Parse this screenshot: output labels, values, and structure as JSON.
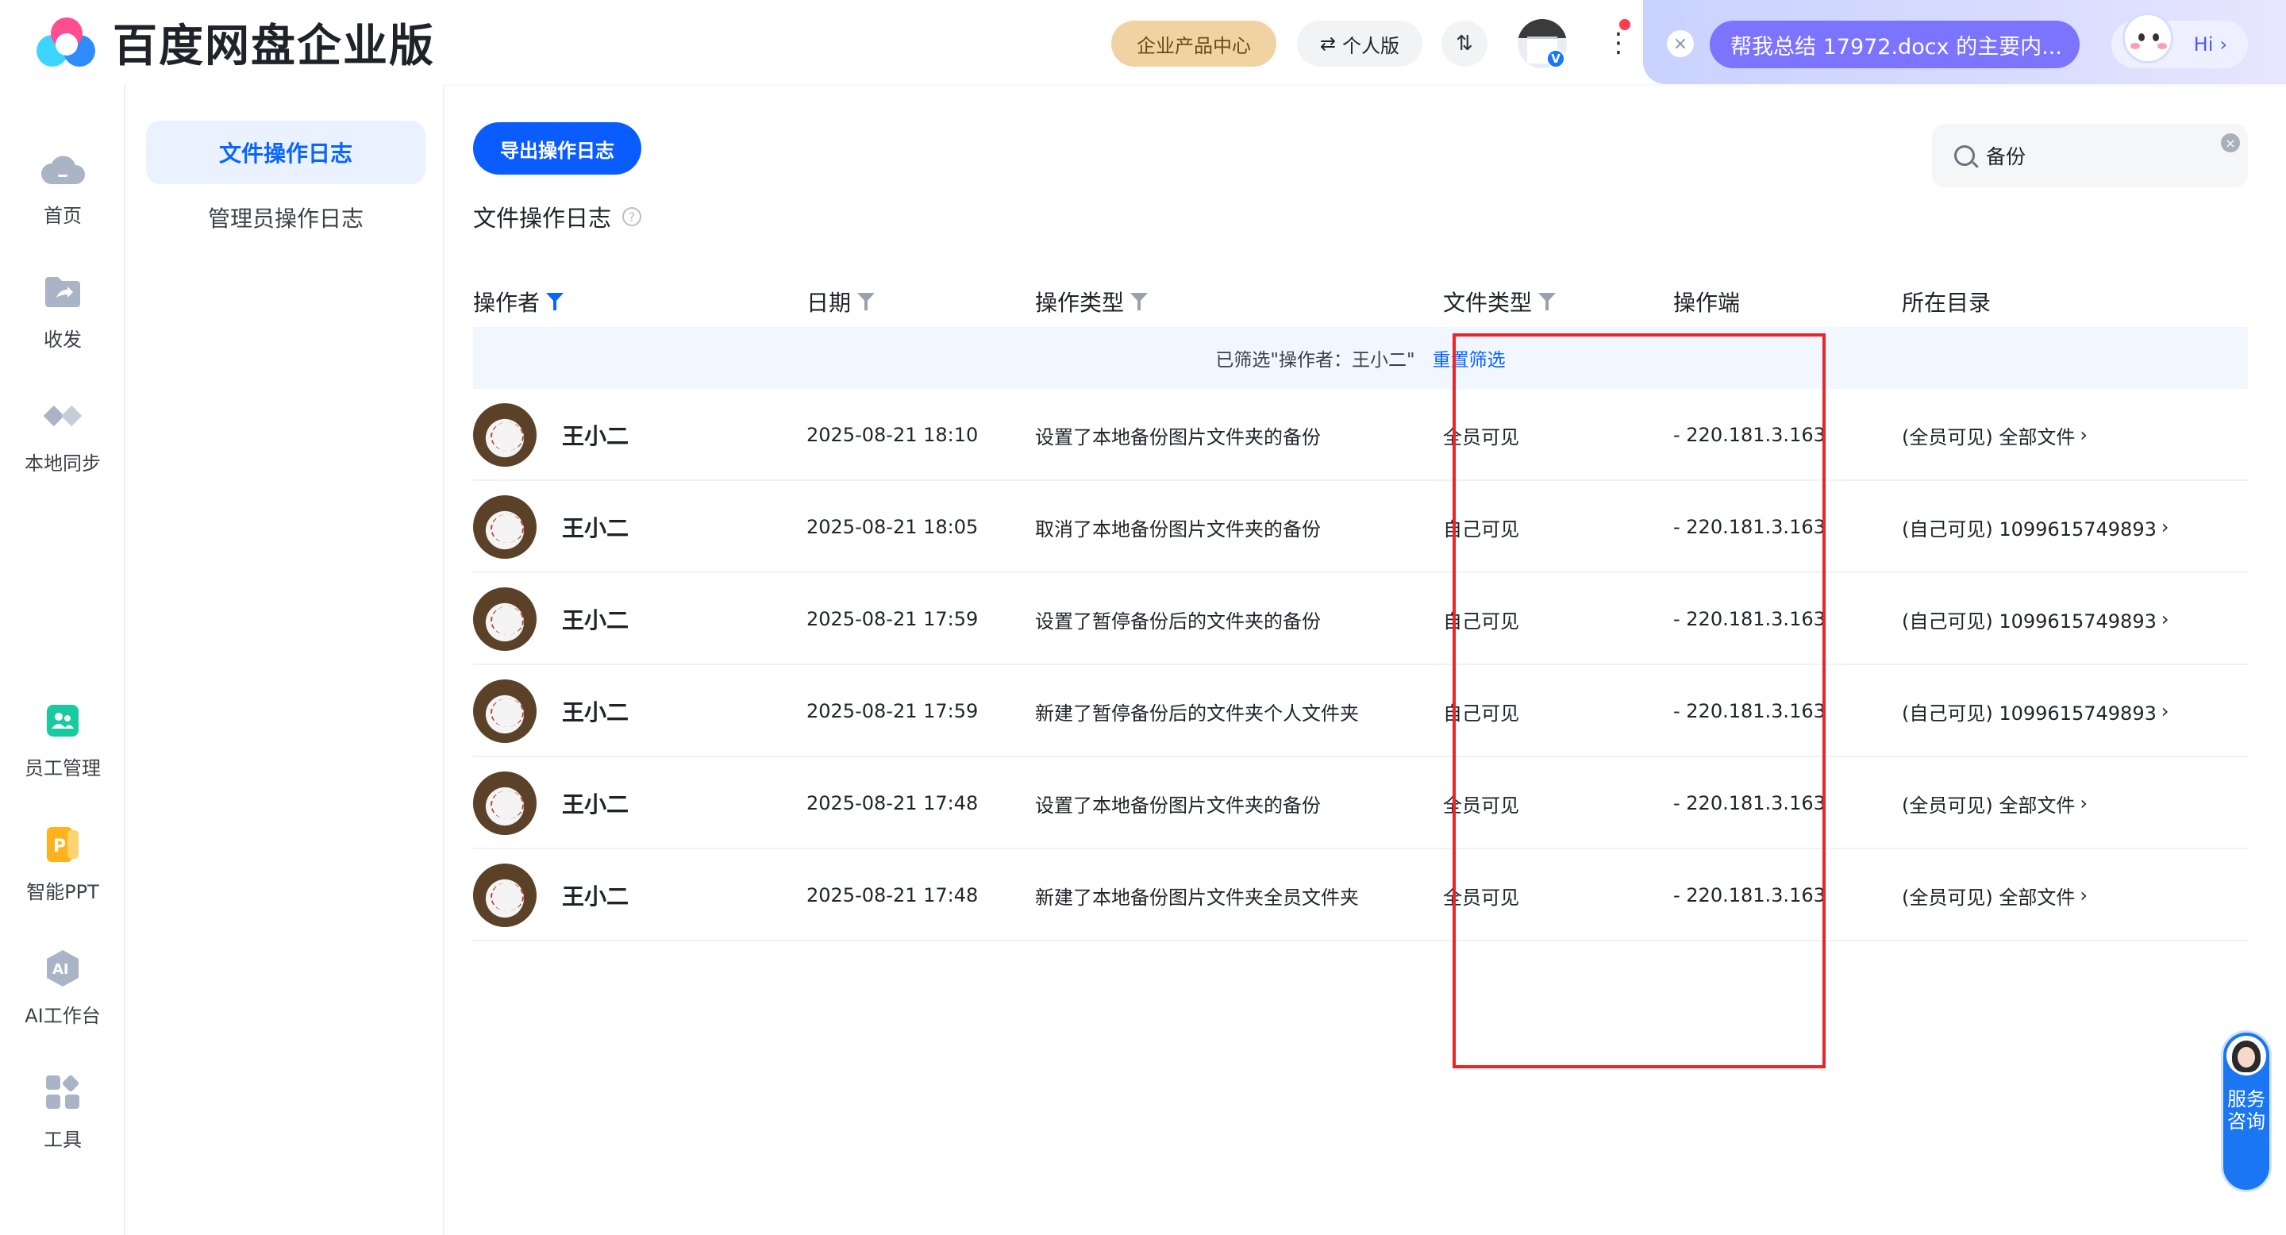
{
  "brand": {
    "name": "百度网盘企业版"
  },
  "header": {
    "enterprise_center": "企业产品中心",
    "personal_label": "个人版",
    "transfer_icon": "transfer-icon",
    "ai_prompt": "帮我总结 17972.docx 的主要内...",
    "ai_hi": "Hi",
    "badge": "V"
  },
  "rail": {
    "items": [
      {
        "label": "首页",
        "icon": "cloud-icon"
      },
      {
        "label": "收发",
        "icon": "folder-share-icon"
      },
      {
        "label": "本地同步",
        "icon": "sync-icon"
      },
      {
        "label": "员工管理",
        "icon": "staff-icon"
      },
      {
        "label": "智能PPT",
        "icon": "ppt-icon"
      },
      {
        "label": "AI工作台",
        "icon": "ai-workbench-icon"
      },
      {
        "label": "工具",
        "icon": "tools-icon"
      }
    ]
  },
  "subnav": {
    "items": [
      {
        "label": "文件操作日志",
        "active": true
      },
      {
        "label": "管理员操作日志",
        "active": false
      }
    ]
  },
  "main": {
    "export_button": "导出操作日志",
    "title": "文件操作日志",
    "help": "?",
    "search": {
      "value": "备份"
    }
  },
  "table": {
    "columns": [
      "操作者",
      "日期",
      "操作类型",
      "文件类型",
      "操作端",
      "所在目录"
    ],
    "filter_banner": {
      "text": "已筛选\"操作者：王小二\"",
      "reset": "重置筛选"
    },
    "rows": [
      {
        "operator": "王小二",
        "date": "2025-08-21 18:10",
        "action": "设置了本地备份图片文件夹的备份",
        "file_type": "全员可见",
        "client": "- 220.181.3.163",
        "directory": "(全员可见) 全部文件"
      },
      {
        "operator": "王小二",
        "date": "2025-08-21 18:05",
        "action": "取消了本地备份图片文件夹的备份",
        "file_type": "自己可见",
        "client": "- 220.181.3.163",
        "directory": "(自己可见) 1099615749893"
      },
      {
        "operator": "王小二",
        "date": "2025-08-21 17:59",
        "action": "设置了暂停备份后的文件夹的备份",
        "file_type": "自己可见",
        "client": "- 220.181.3.163",
        "directory": "(自己可见) 1099615749893"
      },
      {
        "operator": "王小二",
        "date": "2025-08-21 17:59",
        "action": "新建了暂停备份后的文件夹个人文件夹",
        "file_type": "自己可见",
        "client": "- 220.181.3.163",
        "directory": "(自己可见) 1099615749893"
      },
      {
        "operator": "王小二",
        "date": "2025-08-21 17:48",
        "action": "设置了本地备份图片文件夹的备份",
        "file_type": "全员可见",
        "client": "- 220.181.3.163",
        "directory": "(全员可见) 全部文件"
      },
      {
        "operator": "王小二",
        "date": "2025-08-21 17:48",
        "action": "新建了本地备份图片文件夹全员文件夹",
        "file_type": "全员可见",
        "client": "- 220.181.3.163",
        "directory": "(全员可见) 全部文件"
      }
    ]
  },
  "service": {
    "label": "服务咨询"
  },
  "colors": {
    "accent": "#0a5cff",
    "highlight": "#e5262a",
    "enterprise_pill": "#f1d2a3",
    "ai_button": "#7c73ff"
  }
}
